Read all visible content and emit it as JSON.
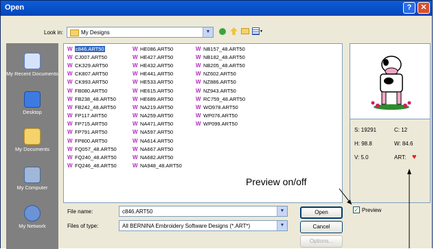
{
  "window": {
    "title": "Open"
  },
  "lookin": {
    "label": "Look in:",
    "value": "My Designs"
  },
  "places": [
    {
      "label": "My Recent Documents",
      "icon": "recent-documents-icon"
    },
    {
      "label": "Desktop",
      "icon": "desktop-icon"
    },
    {
      "label": "My Documents",
      "icon": "my-documents-icon"
    },
    {
      "label": "My Computer",
      "icon": "my-computer-icon"
    },
    {
      "label": "My Network",
      "icon": "my-network-icon"
    }
  ],
  "files": {
    "col1": [
      "c846.ART50",
      "CJ007.ART50",
      "CK329.ART50",
      "CK807.ART50",
      "CK993.ART50",
      "FB080.ART50",
      "FB238_48.ART50",
      "FB242_48.ART50",
      "FP117.ART50",
      "FP715.ART50",
      "FP791.ART50",
      "FP800.ART50",
      "FQ057_48.ART50",
      "FQ240_48.ART50",
      "FQ246_48.ART50"
    ],
    "col2": [
      "HE086.ART50",
      "HE427.ART50",
      "HE432.ART50",
      "HE441.ART50",
      "HE533.ART50",
      "HE615.ART50",
      "HE689.ART50",
      "NA219.ART50",
      "NA259.ART50",
      "NA471.ART50",
      "NA597.ART50",
      "NA614.ART50",
      "NA667.ART50",
      "NA682.ART50",
      "NA948_48.ART50"
    ],
    "col3": [
      "NB157_48.ART50",
      "NB182_48.ART50",
      "NB205_48.ART50",
      "NZ602.ART50",
      "NZ886.ART50",
      "NZ943.ART50",
      "RC759_48.ART50",
      "WO978.ART50",
      "WP076.ART50",
      "WP099.ART50"
    ],
    "selected": "c846.ART50"
  },
  "filename": {
    "label": "File name:",
    "value": "c846.ART50"
  },
  "filetype": {
    "label": "Files of type:",
    "value": "All BERNINA Embroidery Software Designs (*.ART*)"
  },
  "buttons": {
    "open": "Open",
    "cancel": "Cancel",
    "options": "Options..."
  },
  "preview_toggle": {
    "label": "Preview",
    "checked": true
  },
  "stats": {
    "s": "S: 19291",
    "c": "C: 12",
    "h": "H: 98.8",
    "w": "W: 84.6",
    "v": "V: 5.0",
    "art": "ART:"
  },
  "annotation": {
    "preview_onoff": "Preview on/off"
  },
  "colors": {
    "accent": "#316ac5",
    "title_bar": "#0a5fd8",
    "art_heart": "#e02020"
  }
}
